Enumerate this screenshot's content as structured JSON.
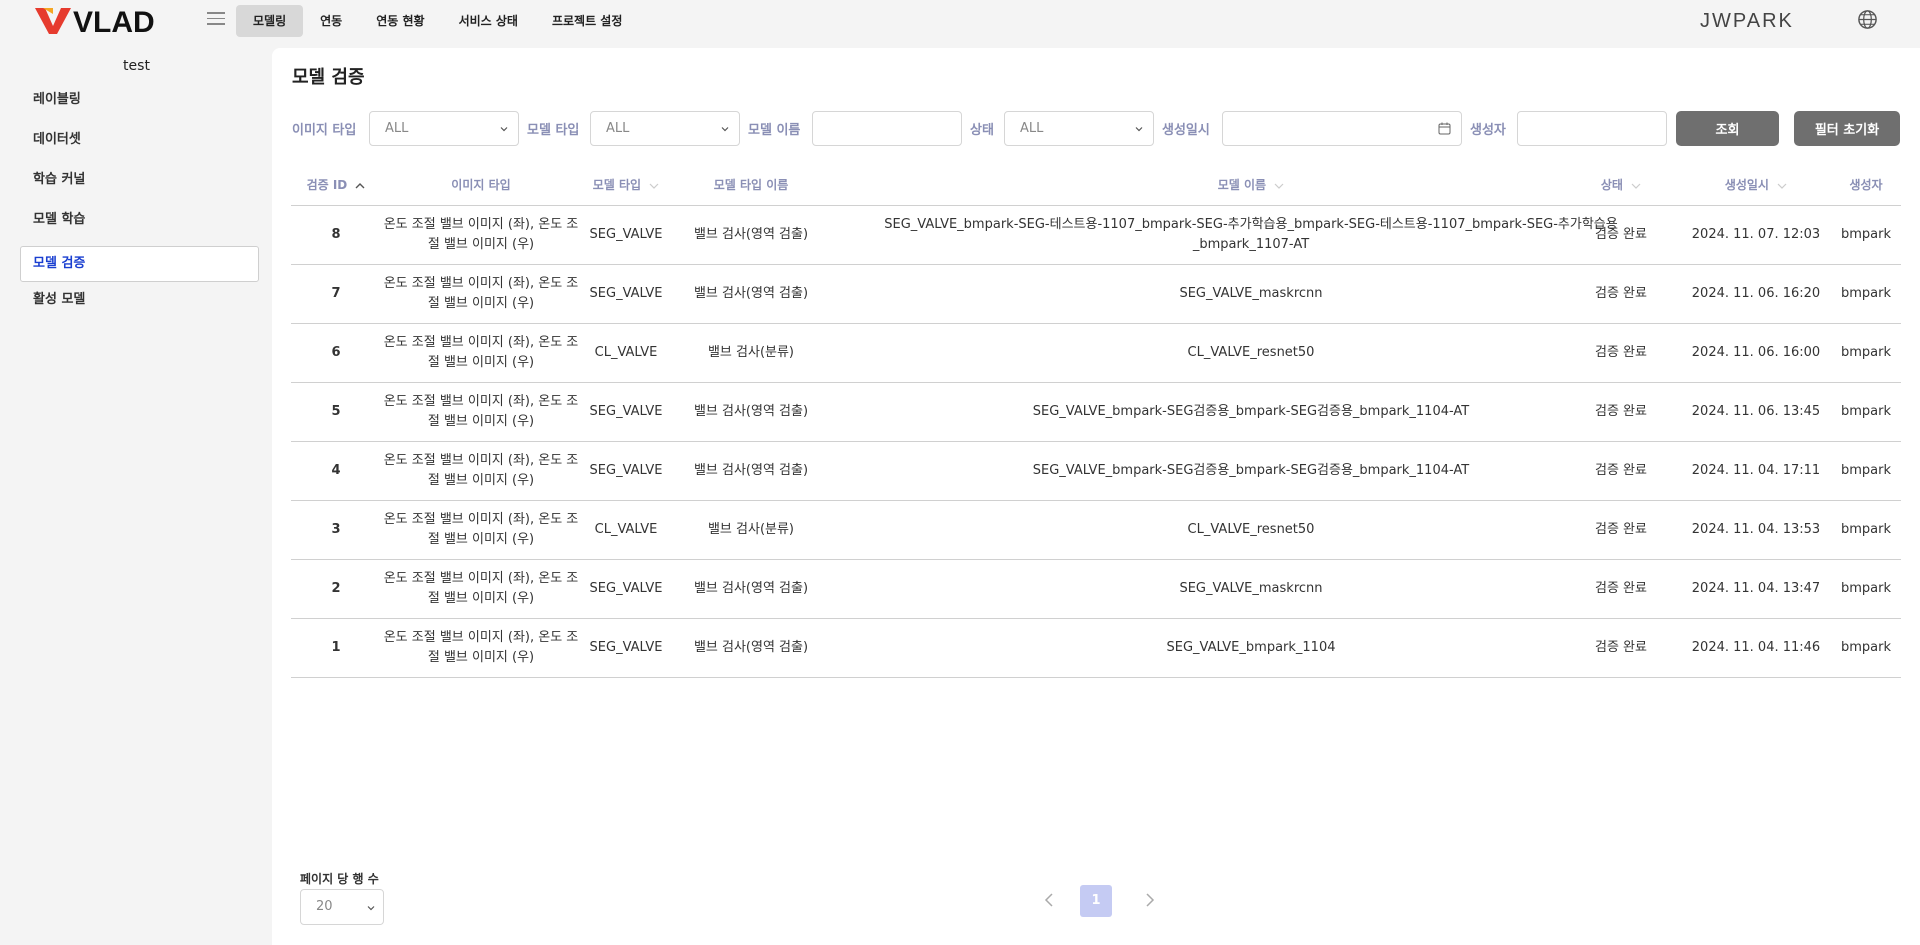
{
  "header": {
    "logo_text": "VLAD",
    "nav": [
      "모델링",
      "연동",
      "연동 현황",
      "서비스 상태",
      "프로젝트 설정"
    ],
    "user_name": "JWPARK"
  },
  "sidebar": {
    "project_name": "test",
    "items": [
      "레이블링",
      "데이터셋",
      "학습 커널",
      "모델 학습",
      "모델 검증",
      "활성 모델"
    ]
  },
  "page": {
    "title": "모델 검증"
  },
  "filters": {
    "image_type_label": "이미지 타입",
    "image_type_value": "ALL",
    "model_type_label": "모델 타입",
    "model_type_value": "ALL",
    "model_name_label": "모델 이름",
    "model_name_value": "",
    "status_label": "상태",
    "status_value": "ALL",
    "created_label": "생성일시",
    "created_value": "",
    "creator_label": "생성자",
    "creator_value": "",
    "search_button": "조회",
    "reset_button": "필터 초기화"
  },
  "table": {
    "columns": [
      "검증 ID",
      "이미지 타입",
      "모델 타입",
      "모델 타입 이름",
      "모델 이름",
      "상태",
      "생성일시",
      "생성자"
    ],
    "rows": [
      {
        "id": "8",
        "image_type": "온도 조절 밸브 이미지 (좌), 온도 조절 밸브 이미지 (우)",
        "model_type": "SEG_VALVE",
        "model_type_name": "밸브 검사(영역 검출)",
        "model_name": "SEG_VALVE_bmpark-SEG-테스트용-1107_bmpark-SEG-추가학습용_bmpark-SEG-테스트용-1107_bmpark-SEG-추가학습용_bmpark_1107-AT",
        "status": "검증 완료",
        "created": "2024. 11. 07. 12:03",
        "creator": "bmpark"
      },
      {
        "id": "7",
        "image_type": "온도 조절 밸브 이미지 (좌), 온도 조절 밸브 이미지 (우)",
        "model_type": "SEG_VALVE",
        "model_type_name": "밸브 검사(영역 검출)",
        "model_name": "SEG_VALVE_maskrcnn",
        "status": "검증 완료",
        "created": "2024. 11. 06. 16:20",
        "creator": "bmpark"
      },
      {
        "id": "6",
        "image_type": "온도 조절 밸브 이미지 (좌), 온도 조절 밸브 이미지 (우)",
        "model_type": "CL_VALVE",
        "model_type_name": "밸브 검사(분류)",
        "model_name": "CL_VALVE_resnet50",
        "status": "검증 완료",
        "created": "2024. 11. 06. 16:00",
        "creator": "bmpark"
      },
      {
        "id": "5",
        "image_type": "온도 조절 밸브 이미지 (좌), 온도 조절 밸브 이미지 (우)",
        "model_type": "SEG_VALVE",
        "model_type_name": "밸브 검사(영역 검출)",
        "model_name": "SEG_VALVE_bmpark-SEG검증용_bmpark-SEG검증용_bmpark_1104-AT",
        "status": "검증 완료",
        "created": "2024. 11. 06. 13:45",
        "creator": "bmpark"
      },
      {
        "id": "4",
        "image_type": "온도 조절 밸브 이미지 (좌), 온도 조절 밸브 이미지 (우)",
        "model_type": "SEG_VALVE",
        "model_type_name": "밸브 검사(영역 검출)",
        "model_name": "SEG_VALVE_bmpark-SEG검증용_bmpark-SEG검증용_bmpark_1104-AT",
        "status": "검증 완료",
        "created": "2024. 11. 04. 17:11",
        "creator": "bmpark"
      },
      {
        "id": "3",
        "image_type": "온도 조절 밸브 이미지 (좌), 온도 조절 밸브 이미지 (우)",
        "model_type": "CL_VALVE",
        "model_type_name": "밸브 검사(분류)",
        "model_name": "CL_VALVE_resnet50",
        "status": "검증 완료",
        "created": "2024. 11. 04. 13:53",
        "creator": "bmpark"
      },
      {
        "id": "2",
        "image_type": "온도 조절 밸브 이미지 (좌), 온도 조절 밸브 이미지 (우)",
        "model_type": "SEG_VALVE",
        "model_type_name": "밸브 검사(영역 검출)",
        "model_name": "SEG_VALVE_maskrcnn",
        "status": "검증 완료",
        "created": "2024. 11. 04. 13:47",
        "creator": "bmpark"
      },
      {
        "id": "1",
        "image_type": "온도 조절 밸브 이미지 (좌), 온도 조절 밸브 이미지 (우)",
        "model_type": "SEG_VALVE",
        "model_type_name": "밸브 검사(영역 검출)",
        "model_name": "SEG_VALVE_bmpark_1104",
        "status": "검증 완료",
        "created": "2024. 11. 04. 11:46",
        "creator": "bmpark"
      }
    ]
  },
  "pagination": {
    "rows_per_page_label": "페이지 당 행 수",
    "rows_per_page_value": "20",
    "current_page": "1"
  },
  "colors": {
    "accent": "#1a3fd0",
    "header_text": "#8a8fb5",
    "button": "#6f6f6f",
    "active_page": "#c5cbf3"
  }
}
